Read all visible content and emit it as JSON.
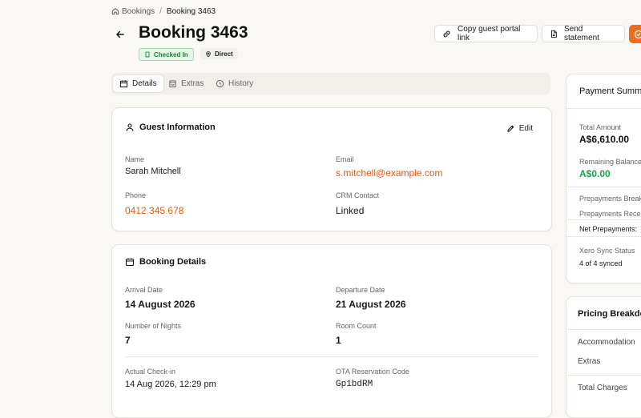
{
  "breadcrumb": {
    "root": "Bookings",
    "separator": "/",
    "current": "Booking 3463"
  },
  "header": {
    "title": "Booking 3463",
    "status_badge": "Checked In",
    "source_badge": "Direct",
    "copy_link_label": "Copy guest portal link",
    "send_statement_label": "Send statement"
  },
  "tabs": [
    {
      "label": "Details",
      "icon": "calendar-icon",
      "active": true
    },
    {
      "label": "Extras",
      "icon": "bag-icon",
      "active": false
    },
    {
      "label": "History",
      "icon": "clock-icon",
      "active": false
    }
  ],
  "guest": {
    "title": "Guest Information",
    "edit_label": "Edit",
    "name_label": "Name",
    "name": "Sarah Mitchell",
    "email_label": "Email",
    "email": "s.mitchell@example.com",
    "phone_label": "Phone",
    "phone": "0412 345 678",
    "crm_label": "CRM Contact",
    "crm": "Linked"
  },
  "booking": {
    "title": "Booking Details",
    "arrival_label": "Arrival Date",
    "arrival": "14 August 2026",
    "departure_label": "Departure Date",
    "departure": "21 August 2026",
    "nights_label": "Number of Nights",
    "nights": "7",
    "rooms_label": "Room Count",
    "rooms": "1",
    "checkin_label": "Actual Check-in",
    "checkin": "14 Aug 2026, 12:29 pm",
    "ota_label": "OTA Reservation Code",
    "ota": "Gp1bdRM"
  },
  "payment": {
    "title": "Payment Summary",
    "total_label": "Total Amount",
    "total": "A$6,610.00",
    "remaining_label": "Remaining Balance",
    "remaining": "A$0.00",
    "prepay_breakdown": "Prepayments Breakdown",
    "prepay_received": "Prepayments Received",
    "net_prepay": "Net Prepayments:",
    "xero_label": "Xero Sync Status",
    "xero": "4 of 4 synced"
  },
  "pricing": {
    "title": "Pricing Breakdown",
    "accommodation": "Accommodation",
    "extras": "Extras",
    "total_charges": "Total Charges"
  },
  "colors": {
    "accent": "#f26a1b",
    "link": "#e8590c",
    "success": "#16a34a",
    "badge_bg": "#e3f6e8"
  }
}
